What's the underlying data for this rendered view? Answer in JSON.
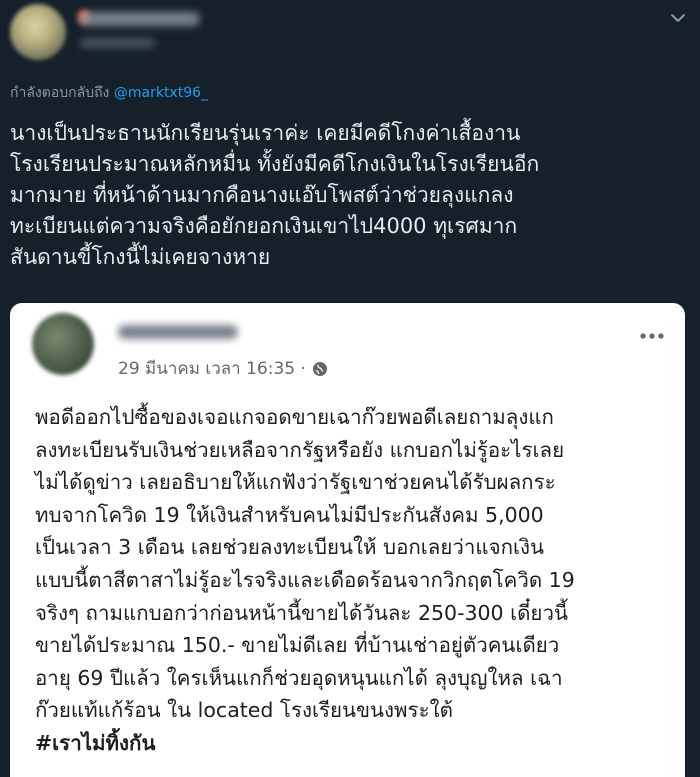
{
  "reply": {
    "prefix": "กำลังตอบกลับถึง",
    "mention": "@marktxt96_"
  },
  "tweet": {
    "lines": [
      "นางเป็นประธานนักเรียนรุ่นเราค่ะ เคยมีคดีโกงค่าเสื้องาน",
      "โรงเรียนประมาณหลักหมื่น ทั้งยังมีคดีโกงเงินในโรงเรียนอีก",
      "มากมาย ที่หน้าด้านมากคือนางแอ๊บโพสต์ว่าช่วยลุงแกลง",
      "ทะเบียนแต่ความจริงคือยักยอกเงินเขาไป4000 ทุเรศมาก",
      "สันดานขี้โกงนี้ไม่เคยจางหาย"
    ]
  },
  "embedded_post": {
    "date": "29 มีนาคม เวลา 16:35 ·",
    "lines": [
      "พอดีออกไปซื้อของเจอแกจอดขายเฉาก๊วยพอดีเลยถามลุงแก",
      "ลงทะเบียนรับเงินช่วยเหลือจากรัฐหรือยัง แกบอกไม่รู้อะไรเลย",
      "ไม่ได้ดูข่าว เลยอธิบายให้แกฟังว่ารัฐเขาช่วยคนได้รับผลกระ",
      "ทบจากโควิด 19 ให้เงินสำหรับคนไม่มีประกันสังคม 5,000",
      "เป็นเวลา 3 เดือน เลยช่วยลงทะเบียนให้ บอกเลยว่าแจกเงิน",
      "แบบนี้ตาสีตาสาไม่รู้อะไรจริงและเดือดร้อนจากวิกฤตโควิด 19",
      "จริงๆ ถามแกบอกว่าก่อนหน้านี้ขายได้วันละ 250-300 เดี๋ยวนี้",
      "ขายได้ประมาณ 150.- ขายไม่ดีเลย ที่บ้านเช่าอยู่ตัวคนเดียว",
      "อายุ 69 ปีแล้ว ใครเห็นแกก็ช่วยอุดหนุนแกได้ ลุงบุญใหล เฉา",
      "ก๊วยแท้แก้ร้อน ใน located โรงเรียนขนงพระใต้"
    ],
    "hashtag": "#เราไม่ทิ้งกัน"
  },
  "icons": [
    "chevron-down-icon",
    "globe-icon",
    "more-horizontal-icon"
  ],
  "colors": {
    "background": "#15202b",
    "mention": "#1da1f2",
    "card": "#ffffff"
  }
}
